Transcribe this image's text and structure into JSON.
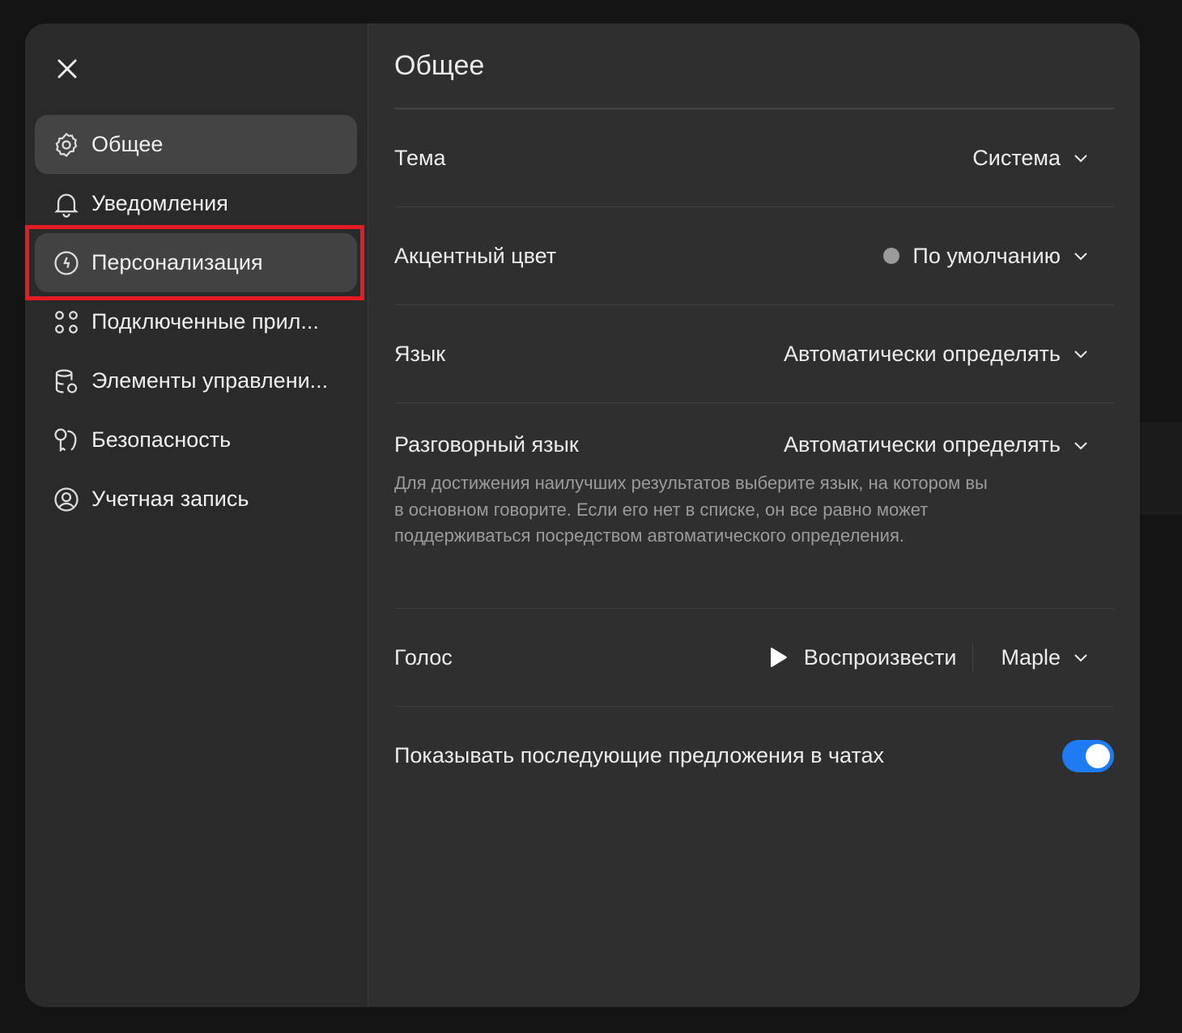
{
  "sidebar": {
    "items": [
      {
        "label": "Общее",
        "icon": "gear-icon"
      },
      {
        "label": "Уведомления",
        "icon": "bell-icon"
      },
      {
        "label": "Персонализация",
        "icon": "personalization-icon"
      },
      {
        "label": "Подключенные прил...",
        "icon": "apps-icon"
      },
      {
        "label": "Элементы управлени...",
        "icon": "database-gear-icon"
      },
      {
        "label": "Безопасность",
        "icon": "key-icon"
      },
      {
        "label": "Учетная запись",
        "icon": "user-circle-icon"
      }
    ]
  },
  "main": {
    "title": "Общее",
    "theme": {
      "label": "Тема",
      "value": "Система"
    },
    "accent": {
      "label": "Акцентный цвет",
      "value": "По умолчанию",
      "color": "#9a9a9a"
    },
    "language": {
      "label": "Язык",
      "value": "Автоматически определять"
    },
    "spoken": {
      "label": "Разговорный язык",
      "value": "Автоматически определять",
      "description": "Для достижения наилучших результатов выберите язык, на котором вы в основном говорите. Если его нет в списке, он все равно может поддерживаться посредством автоматического определения."
    },
    "voice": {
      "label": "Голос",
      "play": "Воспроизвести",
      "value": "Maple"
    },
    "followups": {
      "label": "Показывать последующие предложения в чатах",
      "enabled": true
    }
  },
  "colors": {
    "toggle": "#1f7bf2",
    "highlight": "#e51d23"
  }
}
